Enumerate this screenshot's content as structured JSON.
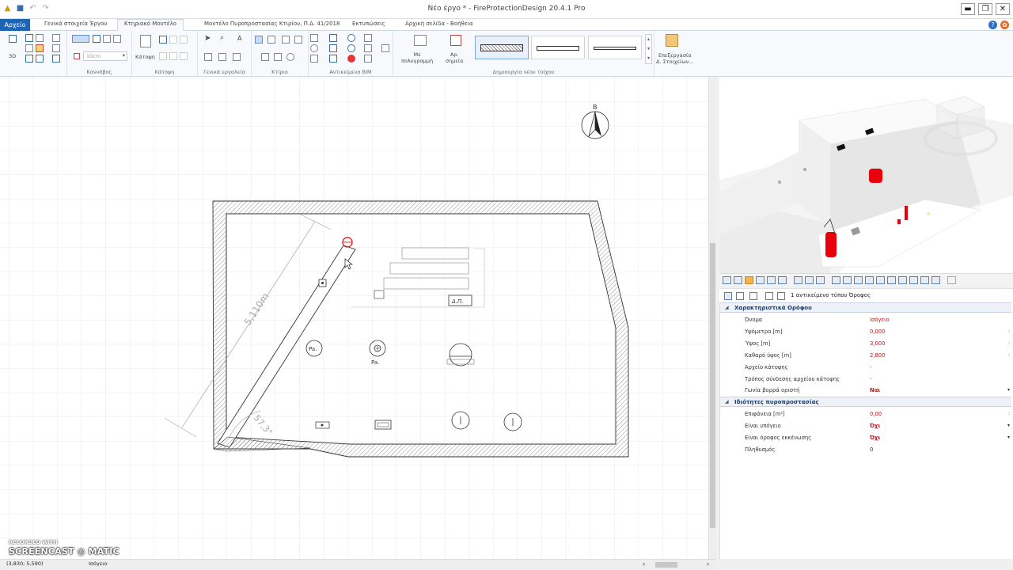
{
  "window": {
    "title": "Νέο έργο * - FireProtectionDesign 20.4.1 Pro",
    "minimize": "▬",
    "maximize": "❐",
    "close": "✕"
  },
  "tabs": {
    "file": "Αρχείο",
    "items": [
      {
        "label": "Γενικά στοιχεία Έργου"
      },
      {
        "label": "Κτηριακό Μοντέλο"
      },
      {
        "label": "Μοντέλο Πυροπροστασίας Κτιρίου, Π.Δ. 41/2018"
      },
      {
        "label": "Εκτυπώσεις"
      },
      {
        "label": "Αρχική σελίδα - Βοήθεια"
      }
    ],
    "active_index": 1
  },
  "ribbon": {
    "groups": {
      "canvas": "Καννάβος",
      "plan": "Κάτοψη",
      "general_tools": "Γενικά εργαλεία",
      "building": "Κτίριο",
      "bim_objects": "Αντικείμενα BIM",
      "new_wall": "Δημιουργία νέου τοίχου"
    },
    "plan_button": "Κάτοψη",
    "grid_size": "10cm",
    "view_3d": "3D",
    "polygon_button": [
      "Με",
      "πολυγραμμή"
    ],
    "points_button": [
      "Αρ.",
      "σημεία"
    ],
    "edit_elements": [
      "Επεξεργασία",
      "Δ. Στοιχείων..."
    ]
  },
  "drawing": {
    "north_label": "Β",
    "dimension_length": "5,110m",
    "dimension_angle": "57,3°",
    "symbol_pa": "Pa.",
    "symbol_dp": "Δ.Π."
  },
  "view3d_toolbar": {
    "active_index": 2
  },
  "properties": {
    "object_count": "1 αντικείμενο τύπου Όροφος",
    "sections": [
      {
        "title": "Χαρακτηριστικά Ορόφου",
        "rows": [
          {
            "name": "Όνομα",
            "value": "Ισόγειο",
            "style": "red",
            "dropdown": ""
          },
          {
            "name": "Υψόμετρο [m]",
            "value": "0,000",
            "style": "red",
            "dropdown": ":"
          },
          {
            "name": "Ύψος [m]",
            "value": "3,000",
            "style": "red",
            "dropdown": ":"
          },
          {
            "name": "Καθαρό ύψος [m]",
            "value": "2,800",
            "style": "red",
            "dropdown": ":"
          },
          {
            "name": "Αρχείο κάτοψης",
            "value": "-",
            "style": "black",
            "dropdown": ""
          },
          {
            "name": "Τρόπος σύνδεσης αρχείου κάτοψης",
            "value": "-",
            "style": "black",
            "dropdown": ""
          },
          {
            "name": "Γωνία βορρά οριστή",
            "value": "Ναι",
            "style": "redb",
            "dropdown": "▾"
          }
        ]
      },
      {
        "title": "Ιδιότητες πυροπροστασίας",
        "rows": [
          {
            "name": "Επιφάνεια [m²]",
            "value": "0,00",
            "style": "red",
            "dropdown": ":"
          },
          {
            "name": "Είναι υπόγειο",
            "value": "Όχι",
            "style": "redb",
            "dropdown": "▾"
          },
          {
            "name": "Είναι όροφος εκκένωσης",
            "value": "Όχι",
            "style": "redb",
            "dropdown": "▾"
          },
          {
            "name": "Πληθυσμός",
            "value": "0",
            "style": "black",
            "dropdown": ""
          }
        ]
      }
    ]
  },
  "status": {
    "coordinates": "(3,830; 5,590)",
    "floor": "Ισόγειο"
  },
  "watermark": {
    "line1": "RECORDED WITH",
    "line2": "SCREENCAST ◎ MATIC"
  },
  "colors": {
    "accent": "#1e64b4",
    "fire_red": "#e8000b",
    "value_red": "#b42020"
  }
}
